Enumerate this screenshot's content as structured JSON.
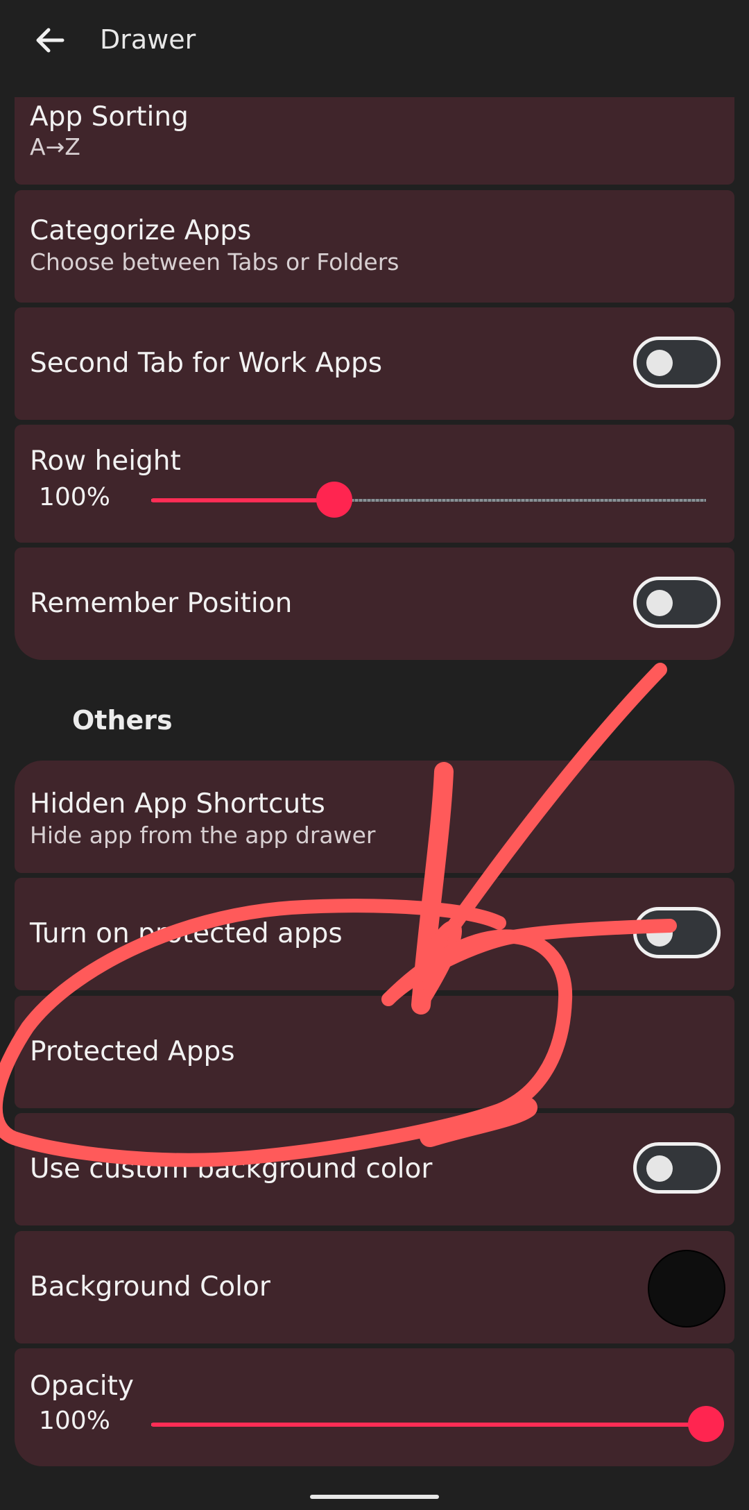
{
  "header": {
    "title": "Drawer",
    "back_icon": "arrow-left-icon"
  },
  "settings": {
    "app_sorting": {
      "title": "App Sorting",
      "value": "A→Z"
    },
    "categorize_apps": {
      "title": "Categorize Apps",
      "subtitle": "Choose between Tabs or Folders"
    },
    "second_tab_work": {
      "title": "Second Tab for Work Apps",
      "enabled": false
    },
    "row_height": {
      "title": "Row height",
      "value_label": "100%",
      "level": 0.33
    },
    "remember_position": {
      "title": "Remember Position",
      "enabled": false
    }
  },
  "others_section": {
    "header": "Others",
    "hidden_app_shortcuts": {
      "title": "Hidden App Shortcuts",
      "subtitle": "Hide app from the app drawer"
    },
    "turn_on_protected": {
      "title": "Turn on protected apps",
      "enabled": false
    },
    "protected_apps": {
      "title": "Protected Apps"
    },
    "custom_background": {
      "title": "Use custom background color",
      "enabled": false
    },
    "background_color": {
      "title": "Background Color",
      "swatch": "#0e0e0e"
    },
    "opacity": {
      "title": "Opacity",
      "value_label": "100%",
      "level": 1.0
    }
  },
  "colors": {
    "background": "#202020",
    "card": "#40252b",
    "accent": "#ff2d55",
    "annotation": "#ff5a5a"
  }
}
